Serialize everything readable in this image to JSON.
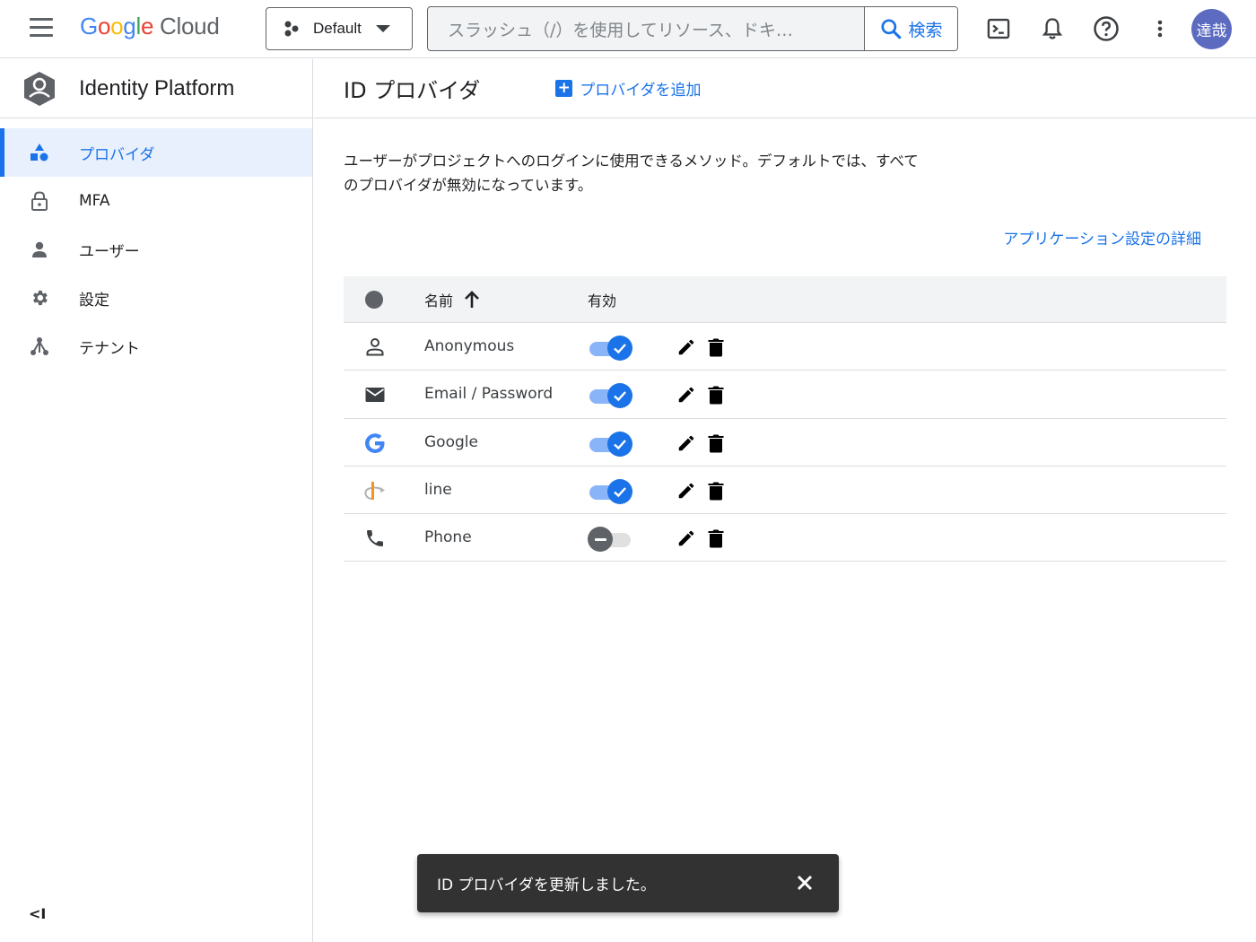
{
  "topbar": {
    "logo_google": [
      "G",
      "o",
      "o",
      "g",
      "l",
      "e"
    ],
    "logo_cloud": "Cloud",
    "project": "Default",
    "search_placeholder": "スラッシュ（/）を使用してリソース、ドキ…",
    "search_button": "検索",
    "avatar": "達哉"
  },
  "sidebar": {
    "product": "Identity Platform",
    "items": [
      {
        "label": "プロバイダ",
        "icon": "shapes-icon",
        "active": true
      },
      {
        "label": "MFA",
        "icon": "lock-icon",
        "active": false
      },
      {
        "label": "ユーザー",
        "icon": "person-icon",
        "active": false
      },
      {
        "label": "設定",
        "icon": "gear-icon",
        "active": false
      },
      {
        "label": "テナント",
        "icon": "tenant-icon",
        "active": false
      }
    ],
    "collapse": "<I"
  },
  "main": {
    "title": "ID プロバイダ",
    "add_button": "プロバイダを追加",
    "description_line1": "ユーザーがプロジェクトへのログインに使用できるメソッド。デフォルトでは、すべて",
    "description_line2": "のプロバイダが無効になっています。",
    "learn_link": "アプリケーション設定の詳細",
    "table": {
      "col_name": "名前",
      "col_enabled": "有効",
      "rows": [
        {
          "name": "Anonymous",
          "icon": "person-outline-icon",
          "enabled": true
        },
        {
          "name": "Email / Password",
          "icon": "mail-icon",
          "enabled": true
        },
        {
          "name": "Google",
          "icon": "google-icon",
          "enabled": true
        },
        {
          "name": "line",
          "icon": "openid-icon",
          "enabled": true
        },
        {
          "name": "Phone",
          "icon": "phone-icon",
          "enabled": false
        }
      ]
    }
  },
  "snackbar": {
    "message": "ID プロバイダを更新しました。"
  },
  "colors": {
    "accent": "#1a73e8",
    "active_bg": "#e8f0fe",
    "snackbar_bg": "#323232"
  }
}
